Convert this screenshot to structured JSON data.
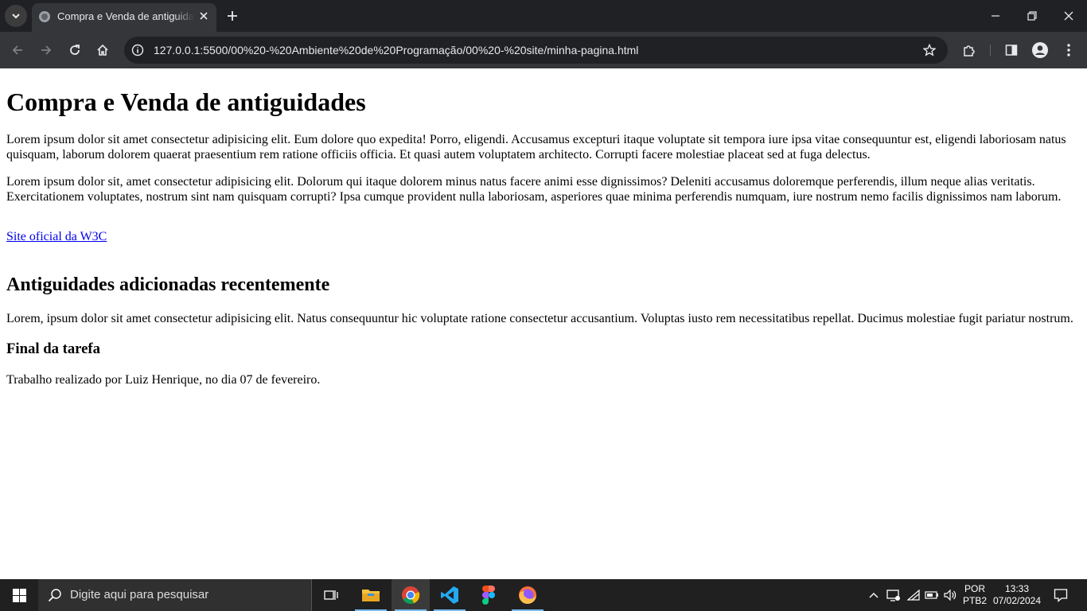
{
  "browser": {
    "tab": {
      "title": "Compra e Venda de antiguidades"
    },
    "url": "127.0.0.1:5500/00%20-%20Ambiente%20de%20Programação/00%20-%20site/minha-pagina.html"
  },
  "page": {
    "h1": "Compra e Venda de antiguidades",
    "p1": "Lorem ipsum dolor sit amet consectetur adipisicing elit. Eum dolore quo expedita! Porro, eligendi. Accusamus excepturi itaque voluptate sit tempora iure ipsa vitae consequuntur est, eligendi laboriosam natus quisquam, laborum dolorem quaerat praesentium rem ratione officiis officia. Et quasi autem voluptatem architecto. Corrupti facere molestiae placeat sed at fuga delectus.",
    "p2": "Lorem ipsum dolor sit, amet consectetur adipisicing elit. Dolorum qui itaque dolorem minus natus facere animi esse dignissimos? Deleniti accusamus doloremque perferendis, illum neque alias veritatis. Exercitationem voluptates, nostrum sint nam quisquam corrupti? Ipsa cumque provident nulla laboriosam, asperiores quae minima perferendis numquam, iure nostrum nemo facilis dignissimos nam laborum.",
    "link": "Site oficial da W3C",
    "h2": "Antiguidades adicionadas recentemente",
    "p3": "Lorem, ipsum dolor sit amet consectetur adipisicing elit. Natus consequuntur hic voluptate ratione consectetur accusantium. Voluptas iusto rem necessitatibus repellat. Ducimus molestiae fugit pariatur nostrum.",
    "h3": "Final da tarefa",
    "p4": "Trabalho realizado por Luiz Henrique, no dia 07 de fevereiro."
  },
  "taskbar": {
    "search_placeholder": "Digite aqui para pesquisar",
    "lang_top": "POR",
    "lang_bottom": "PTB2",
    "time": "13:33",
    "date": "07/02/2024"
  },
  "colors": {
    "tab_strip": "#202124",
    "toolbar": "#35363a",
    "link": "#0000ee",
    "taskbar": "#202020"
  }
}
